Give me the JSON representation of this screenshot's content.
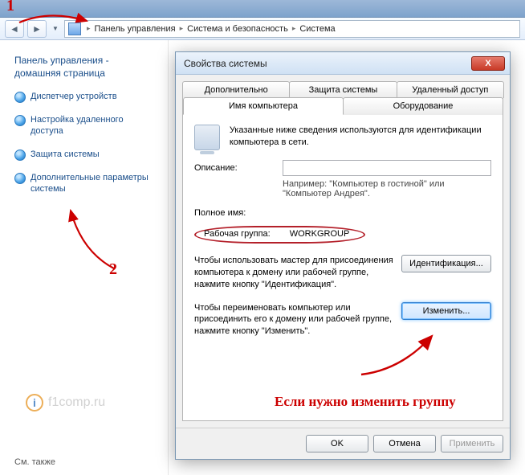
{
  "breadcrumb": {
    "items": [
      "Панель управления",
      "Система и безопасность",
      "Система"
    ]
  },
  "sidebar": {
    "title": "Панель управления - домашняя страница",
    "links": [
      "Диспетчер устройств",
      "Настройка удаленного доступа",
      "Защита системы",
      "Дополнительные параметры системы"
    ],
    "also": "См. также"
  },
  "dialog": {
    "title": "Свойства системы",
    "close": "X",
    "tabs_row1": [
      "Дополнительно",
      "Защита системы",
      "Удаленный доступ"
    ],
    "tabs_row2": [
      "Имя компьютера",
      "Оборудование"
    ],
    "intro": "Указанные ниже сведения используются для идентификации компьютера в сети.",
    "desc_label": "Описание:",
    "desc_value": "",
    "desc_hint": "Например: \"Компьютер в гостиной\" или \"Компьютер Андрея\".",
    "fullname_label": "Полное имя:",
    "fullname_value": "",
    "workgroup_label": "Рабочая группа:",
    "workgroup_value": "WORKGROUP",
    "ident_text": "Чтобы использовать мастер для присоединения компьютера к домену или рабочей группе, нажмите кнопку \"Идентификация\".",
    "ident_btn": "Идентификация...",
    "change_text": "Чтобы переименовать компьютер или присоединить его к домену или рабочей группе, нажмите кнопку \"Изменить\".",
    "change_btn": "Изменить...",
    "ok": "OK",
    "cancel": "Отмена",
    "apply": "Применить"
  },
  "annotations": {
    "n1": "1",
    "n2": "2",
    "caption": "Если нужно изменить группу"
  },
  "watermark": {
    "icon": "i",
    "text": "f1comp.ru"
  }
}
